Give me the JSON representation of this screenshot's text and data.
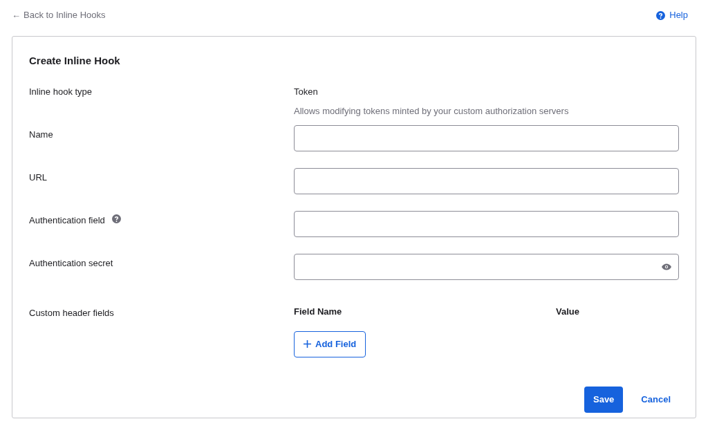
{
  "back_link": {
    "arrow": "←",
    "label": "Back to Inline Hooks"
  },
  "help_link": {
    "label": "Help"
  },
  "form": {
    "title": "Create Inline Hook",
    "rows": [
      {
        "kind": "info",
        "label": "Inline hook type",
        "value": "Token",
        "description": "Allows modifying tokens minted by your custom authorization servers"
      },
      {
        "kind": "text",
        "label": "Name",
        "has_help": false
      },
      {
        "kind": "text",
        "label": "URL",
        "has_help": false
      },
      {
        "kind": "text",
        "label": "Authentication field",
        "has_help": true
      },
      {
        "kind": "secret",
        "label": "Authentication secret",
        "has_help": false
      },
      {
        "kind": "headers",
        "label": "Custom header fields",
        "columns": [
          "Field Name",
          "Value"
        ],
        "add_button": "Add Field"
      }
    ],
    "actions": [
      {
        "label": "Save",
        "primary": true
      },
      {
        "label": "Cancel",
        "primary": false
      }
    ]
  }
}
